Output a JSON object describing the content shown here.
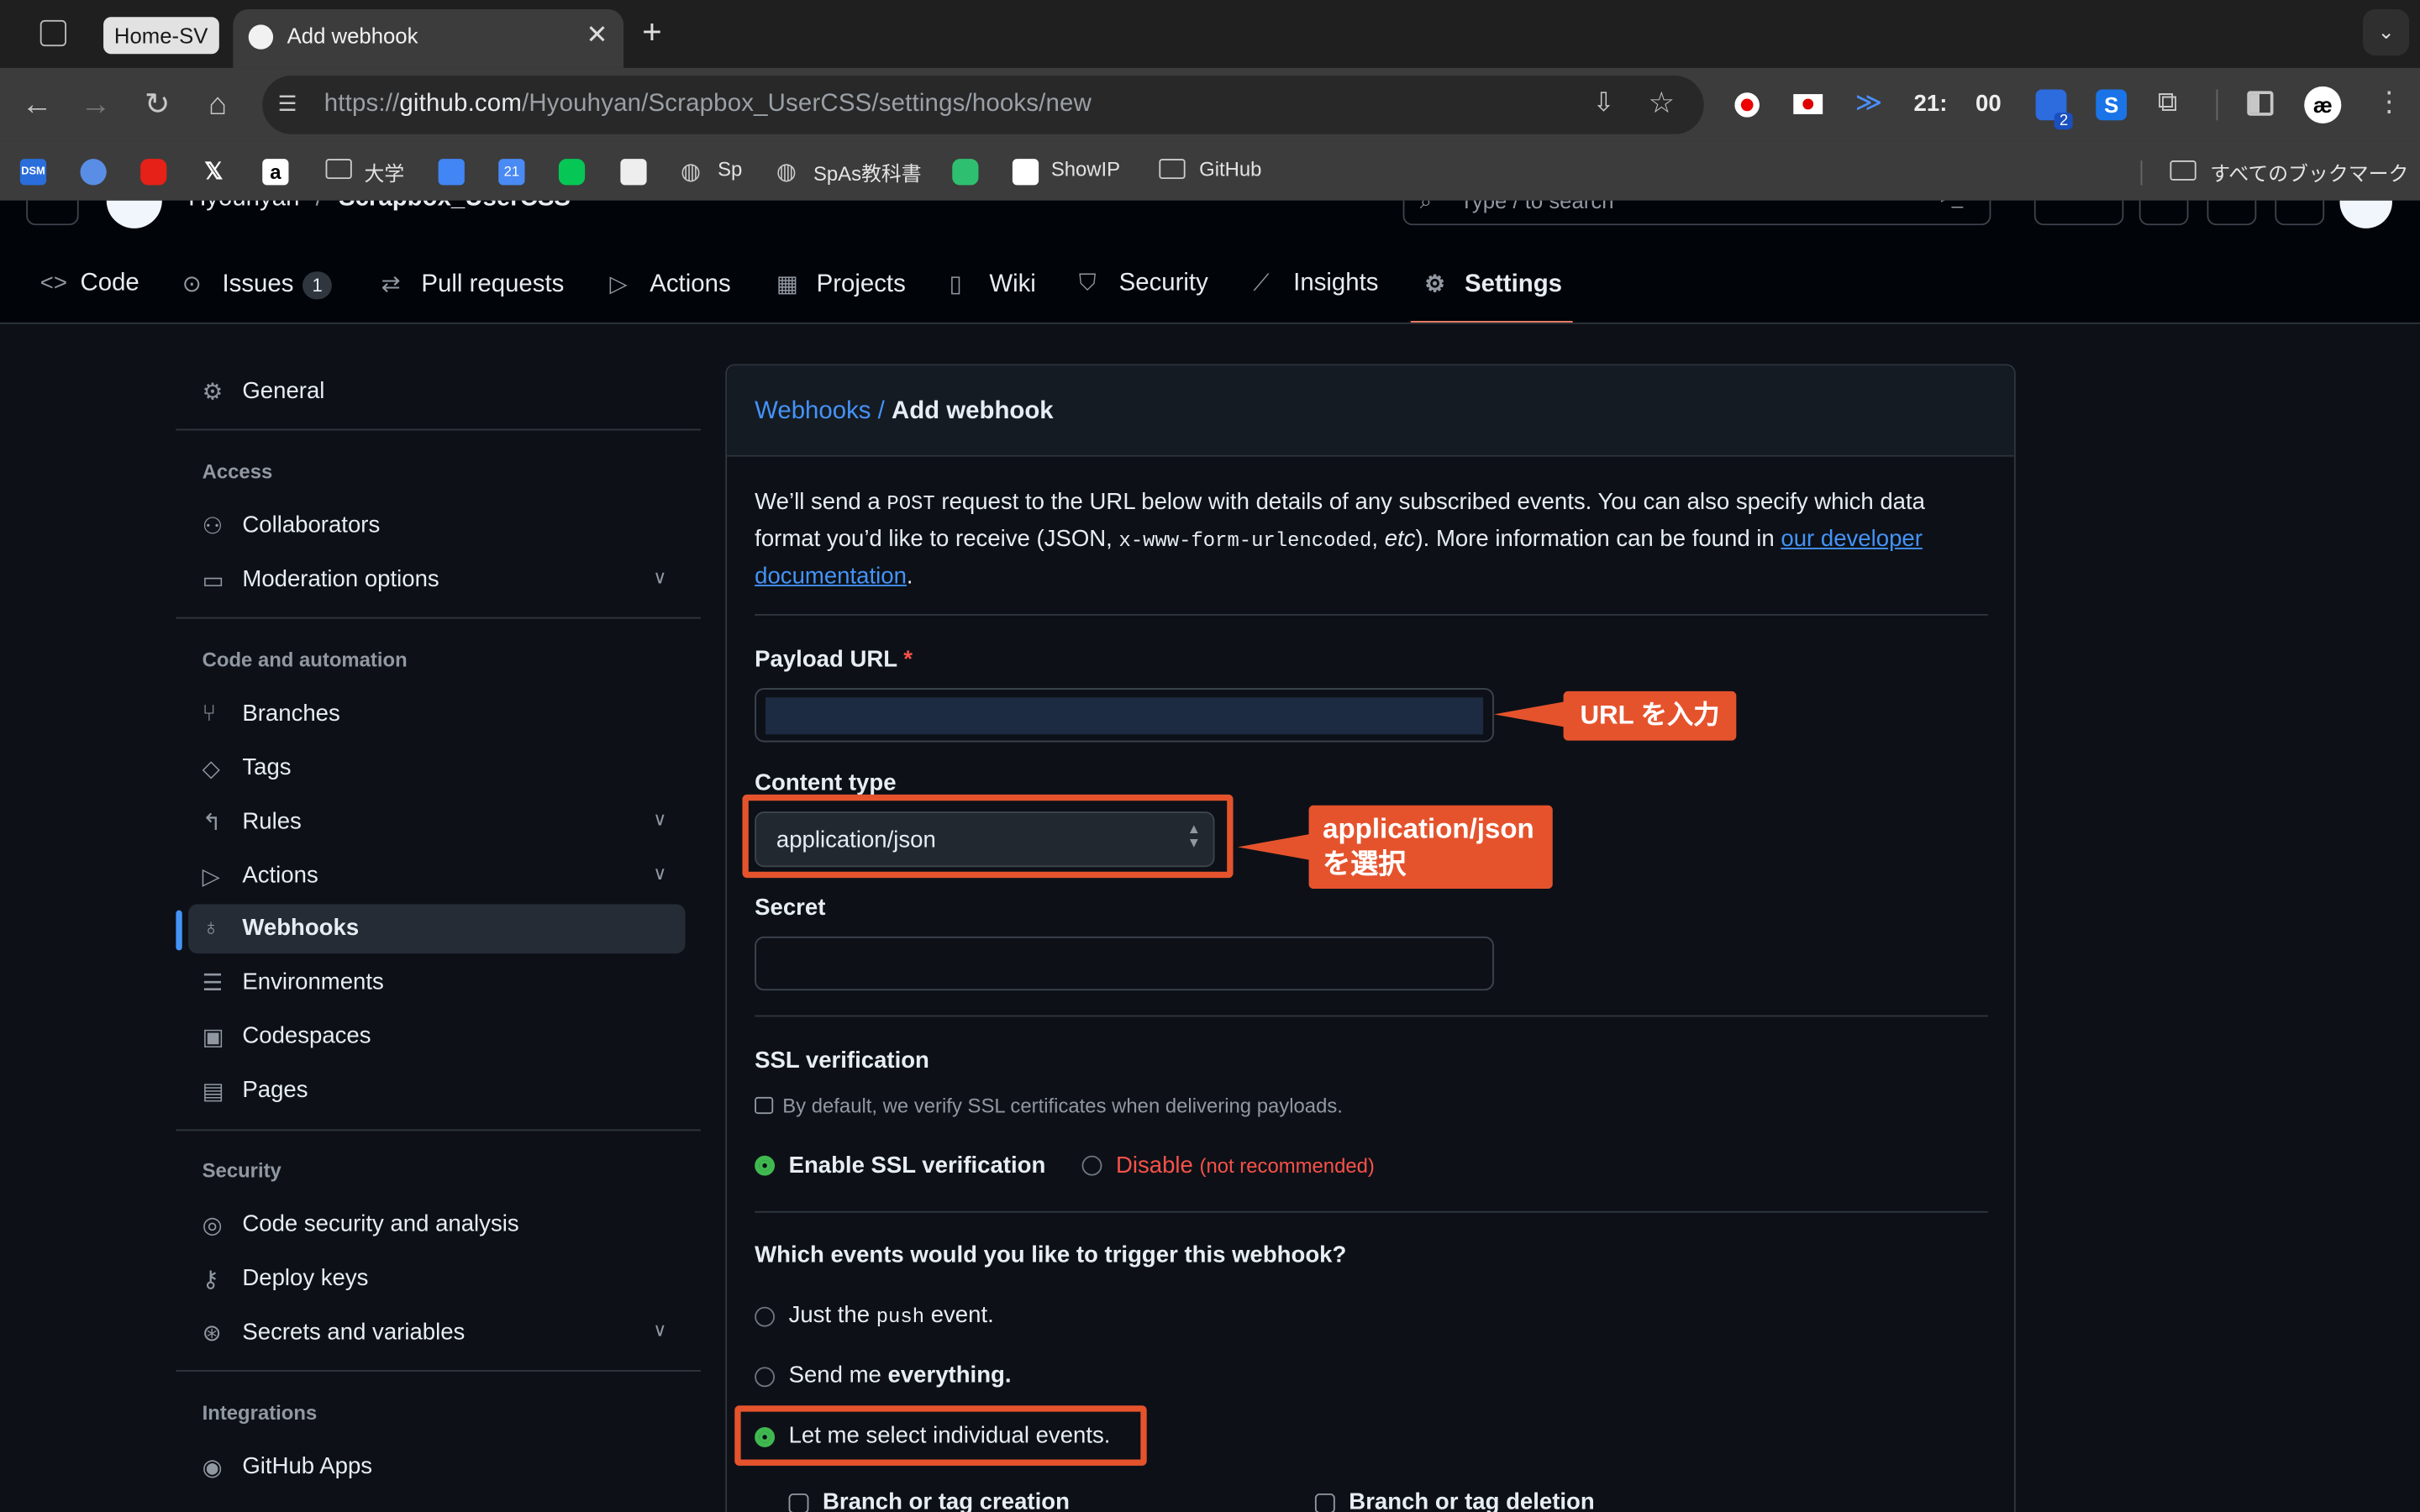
{
  "browser": {
    "tabs": [
      {
        "label": "Home-SV"
      },
      {
        "label": "Add webhook"
      }
    ],
    "url_prefix": "https://",
    "url_host": "github.com",
    "url_path": "/Hyouhyan/Scrapbox_UserCSS/settings/hooks/new",
    "clock_hour": "21:",
    "clock_min": "00",
    "ext_badge": "2",
    "bookmarks": [
      "大学",
      "Sp",
      "SpAs教科書",
      "ShowIP",
      "GitHub"
    ],
    "bookmark_misc": [
      "DSM",
      "21"
    ],
    "all_bookmarks": "すべてのブックマーク"
  },
  "header": {
    "owner": "Hyouhyan",
    "sep": "/",
    "repo": "Scrapbox_UserCSS",
    "search_placeholder": "Type / to search"
  },
  "repo_nav": {
    "code": "Code",
    "issues": "Issues",
    "issues_count": "1",
    "pulls": "Pull requests",
    "actions": "Actions",
    "projects": "Projects",
    "wiki": "Wiki",
    "security": "Security",
    "insights": "Insights",
    "settings": "Settings"
  },
  "sidebar": {
    "general": "General",
    "h_access": "Access",
    "collaborators": "Collaborators",
    "moderation": "Moderation options",
    "h_code": "Code and automation",
    "branches": "Branches",
    "tags": "Tags",
    "rules": "Rules",
    "actions": "Actions",
    "webhooks": "Webhooks",
    "environments": "Environments",
    "codespaces": "Codespaces",
    "pages": "Pages",
    "h_security": "Security",
    "code_security": "Code security and analysis",
    "deploy_keys": "Deploy keys",
    "secrets": "Secrets and variables",
    "h_integrations": "Integrations",
    "github_apps": "GitHub Apps"
  },
  "form": {
    "crumb_link": "Webhooks /",
    "crumb_current": "Add webhook",
    "intro_1": "We’ll send a ",
    "intro_post": "POST",
    "intro_2": " request to the URL below with details of any subscribed events. You can also specify which data format you’d like to receive (JSON, ",
    "intro_enc": "x-www-form-urlencoded",
    "intro_3": ", ",
    "intro_etc": "etc",
    "intro_4": "). More information can be found in ",
    "intro_link": "our developer documentation",
    "intro_5": ".",
    "payload_label": "Payload URL",
    "required_mark": "*",
    "content_type_label": "Content type",
    "content_type_value": "application/json",
    "secret_label": "Secret",
    "ssl_title": "SSL verification",
    "ssl_note": "By default, we verify SSL certificates when delivering payloads.",
    "ssl_enable": "Enable SSL verification",
    "ssl_disable": "Disable",
    "ssl_disable_note": "(not recommended)",
    "events_title": "Which events would you like to trigger this webhook?",
    "ev_just_1": "Just the ",
    "ev_just_code": "push",
    "ev_just_2": " event.",
    "ev_every_1": "Send me ",
    "ev_every_2": "everything.",
    "ev_select": "Let me select individual events.",
    "cb_branch_create": "Branch or tag creation",
    "cb_branch_delete": "Branch or tag deletion"
  },
  "annotations": {
    "url_note": "URL を入力",
    "ctype_note_1": "application/json",
    "ctype_note_2": "を選択",
    "color": "#e5532d"
  }
}
